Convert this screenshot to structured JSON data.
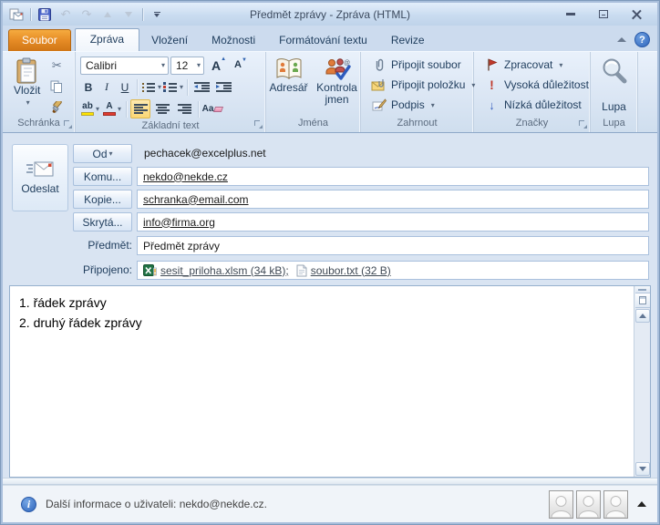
{
  "window": {
    "title": "Předmět zprávy - Zpráva (HTML)"
  },
  "tabs": [
    {
      "label": "Soubor"
    },
    {
      "label": "Zpráva"
    },
    {
      "label": "Vložení"
    },
    {
      "label": "Možnosti"
    },
    {
      "label": "Formátování textu"
    },
    {
      "label": "Revize"
    }
  ],
  "help_label": "?",
  "ribbon": {
    "clipboard": {
      "group": "Schránka",
      "paste": "Vložit",
      "cut_glyph": "✂"
    },
    "basic_text": {
      "group": "Základní text",
      "font_name": "Calibri",
      "font_size": "12",
      "bold": "B",
      "italic": "I",
      "underline": "U",
      "grow": "A",
      "shrink": "A",
      "highlight": "ab",
      "font_color": "A",
      "clear": "Aa"
    },
    "names": {
      "group": "Jména",
      "address_book": "Adresář",
      "check_names": "Kontrola jmen"
    },
    "include": {
      "group": "Zahrnout",
      "attach_file": "Připojit soubor",
      "attach_item": "Připojit položku",
      "signature": "Podpis"
    },
    "tags": {
      "group": "Značky",
      "follow_up": "Zpracovat",
      "high_importance": "Vysoká důležitost",
      "low_importance": "Nízká důležitost",
      "high_glyph": "!",
      "low_glyph": "↓"
    },
    "zoom": {
      "group": "Lupa",
      "zoom_button": "Lupa"
    }
  },
  "form": {
    "send": "Odeslat",
    "from_button": "Od",
    "from_value": "pechacek@excelplus.net",
    "to_button": "Komu...",
    "to_value": "nekdo@nekde.cz",
    "cc_button": "Kopie...",
    "cc_value": "schranka@email.com",
    "bcc_button": "Skrytá...",
    "bcc_value": "info@firma.org",
    "subject_label": "Předmět:",
    "subject_value": "Předmět zprávy",
    "attached_label": "Připojeno:",
    "attachments": [
      {
        "name": "sesit_priloha.xlsm (34 kB);",
        "type": "excel-macro-workbook"
      },
      {
        "name": "soubor.txt (32 B)",
        "type": "text-file"
      }
    ]
  },
  "body": {
    "lines": [
      "1. řádek zprávy",
      "2. druhý řádek zprávy"
    ]
  },
  "people_pane": {
    "info_text": "Další informace o uživateli: nekdo@nekde.cz."
  },
  "colors": {
    "file_tab_orange": "#e68b25",
    "active_toggle_highlight": "#fbd775",
    "chrome_blue": "#cfdeee",
    "form_background": "#d9e4f2",
    "window_border": "#a8bedb",
    "high_importance_red": "#c0392b",
    "low_importance_blue": "#3a62c0",
    "excel_green": "#217346"
  }
}
